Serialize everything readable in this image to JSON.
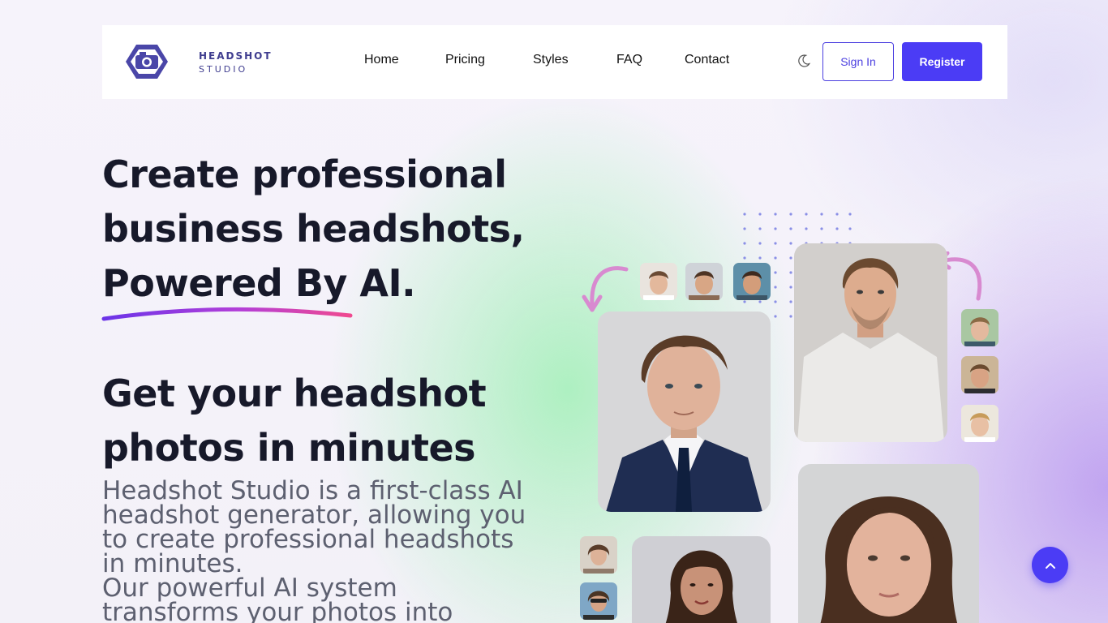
{
  "brand": {
    "line1": "HEADSHOT",
    "line2": "STUDIO",
    "icon": "camera-hexagon-icon",
    "accent_color": "#4b3cf5"
  },
  "nav": {
    "links": [
      "Home",
      "Pricing",
      "Styles",
      "FAQ",
      "Contact"
    ],
    "theme_icon": "moon-icon",
    "signin_label": "Sign In",
    "register_label": "Register"
  },
  "hero": {
    "title_line1": "Create professional",
    "title_line2": "business headshots,",
    "title_line3": "Powered By AI.",
    "subtitle_line1": "Get your headshot",
    "subtitle_line2": "photos in minutes",
    "description_line1": "Headshot Studio is a first-class AI",
    "description_line2": "headshot generator, allowing you",
    "description_line3": "to create professional headshots",
    "description_line4": "in minutes.",
    "description_line5": "Our powerful AI system",
    "description_line6": "transforms your photos into"
  },
  "scroll_top_icon": "chevron-up-icon"
}
